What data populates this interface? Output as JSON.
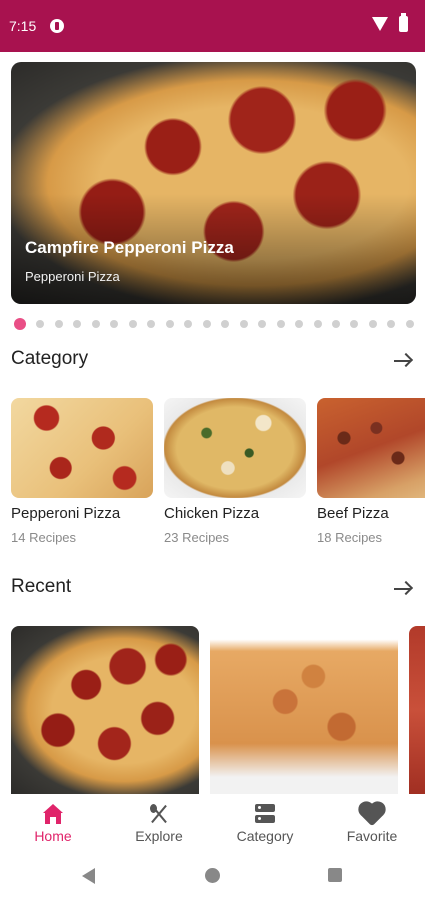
{
  "status_bar": {
    "time": "7:15"
  },
  "hero": {
    "title": "Campfire Pepperoni Pizza",
    "subtitle": "Pepperoni Pizza"
  },
  "carousel": {
    "total": 22,
    "active_index": 0
  },
  "category": {
    "title": "Category",
    "items": [
      {
        "name": "Pepperoni Pizza",
        "count": "14 Recipes"
      },
      {
        "name": "Chicken Pizza",
        "count": "23 Recipes"
      },
      {
        "name": "Beef Pizza",
        "count": "18 Recipes"
      }
    ]
  },
  "recent": {
    "title": "Recent"
  },
  "bottom_nav": {
    "items": [
      {
        "label": "Home",
        "icon": "home-icon",
        "active": true
      },
      {
        "label": "Explore",
        "icon": "fork-spoon-icon",
        "active": false
      },
      {
        "label": "Category",
        "icon": "category-icon",
        "active": false
      },
      {
        "label": "Favorite",
        "icon": "heart-icon",
        "active": false
      }
    ]
  },
  "colors": {
    "status_bar": "#a8124f",
    "accent": "#e0246a",
    "dot_active": "#e94f86"
  }
}
